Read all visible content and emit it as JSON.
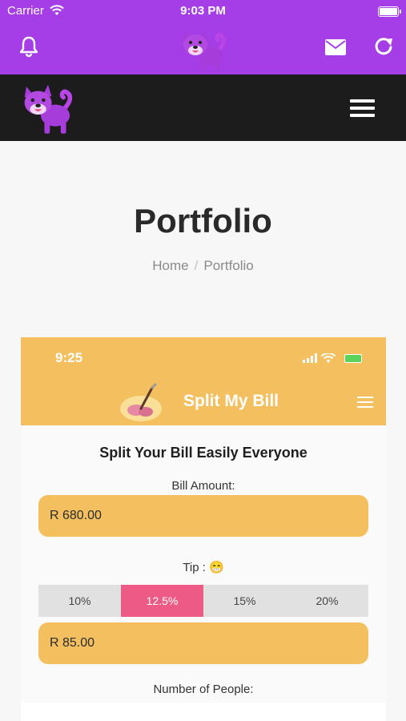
{
  "status_bar": {
    "carrier": "Carrier",
    "time": "9:03 PM"
  },
  "app_bar": {
    "left_icon": "bell-icon",
    "center_logo": "shiba-dog-logo",
    "right_icons": [
      "mail-icon",
      "refresh-icon"
    ],
    "color": "#a53ee6"
  },
  "site_header": {
    "logo": "shiba-dog-logo",
    "menu_icon": "hamburger-icon",
    "color": "#1c1c1c"
  },
  "page": {
    "title": "Portfolio",
    "breadcrumb": {
      "home": "Home",
      "separator": "/",
      "current": "Portfolio"
    }
  },
  "portfolio_screenshot": {
    "status_time": "9:25",
    "app_title": "Split My Bill",
    "heading": "Split Your Bill Easily Everyone",
    "bill_label": "Bill Amount:",
    "bill_value": "R 680.00",
    "tip_label": "Tip : 😁",
    "tip_options": [
      "10%",
      "12.5%",
      "15%",
      "20%"
    ],
    "tip_selected": "12.5%",
    "tip_value": "R 85.00",
    "people_label": "Number of People:",
    "accent": "#f3bf5f",
    "selected_color": "#ec5a85"
  }
}
